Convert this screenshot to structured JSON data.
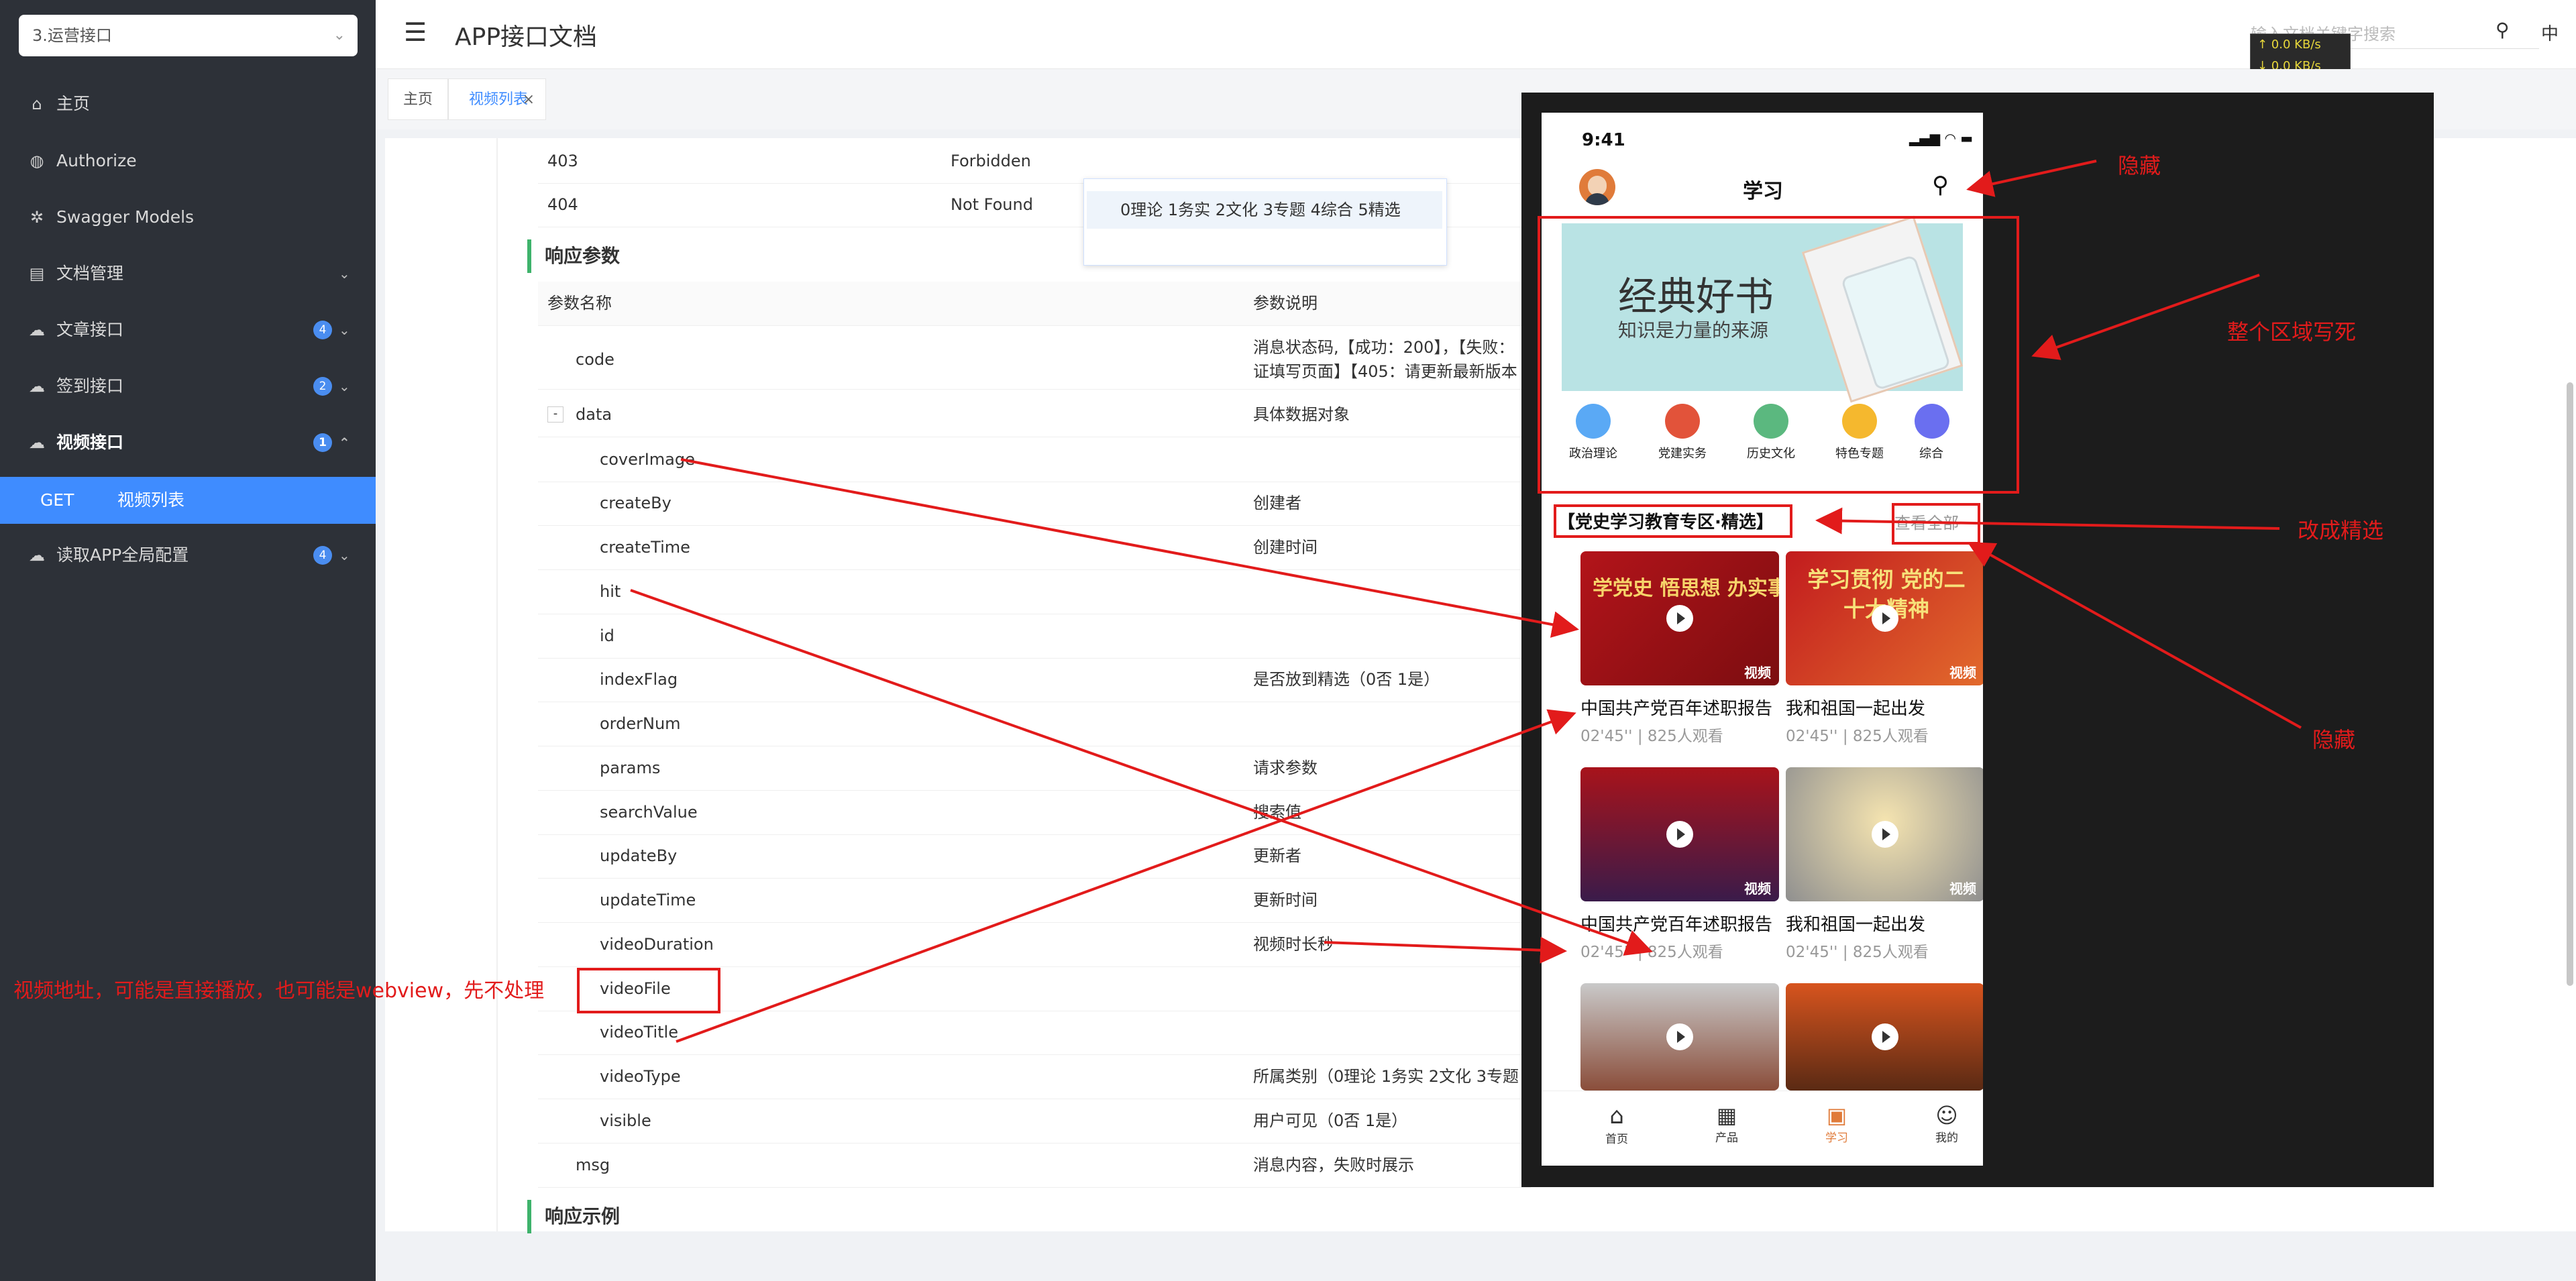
{
  "sidebar": {
    "project": "3.运营接口",
    "items": [
      {
        "label": "主页",
        "icon": "home-icon"
      },
      {
        "label": "Authorize",
        "icon": "authorize-icon"
      },
      {
        "label": "Swagger Models",
        "icon": "models-icon"
      },
      {
        "label": "文档管理",
        "icon": "docs-icon"
      },
      {
        "label": "文章接口",
        "icon": "cloud-icon",
        "badge": "4"
      },
      {
        "label": "签到接口",
        "icon": "cloud-icon",
        "badge": "2"
      },
      {
        "label": "视频接口",
        "icon": "cloud-icon",
        "badge": "1"
      },
      {
        "label": "读取APP全局配置",
        "icon": "cloud-icon",
        "badge": "4"
      }
    ],
    "sub": {
      "method": "GET",
      "label": "视频列表"
    }
  },
  "header": {
    "title": "APP接口文档",
    "search_placeholder": "输入文档关键字搜索",
    "lang": "中",
    "net_up": "↑ 0.0 KB/s",
    "net_down": "↓ 0.0 KB/s"
  },
  "tabs": [
    {
      "label": "主页"
    },
    {
      "label": "视频列表",
      "close": "×"
    }
  ],
  "tooltip": "0理论 1务实 2文化 3专题 4综合 5精选",
  "status_rows": [
    {
      "code": "403",
      "desc": "Forbidden"
    },
    {
      "code": "404",
      "desc": "Not Found"
    }
  ],
  "response": {
    "title": "响应参数",
    "col_name": "参数名称",
    "col_desc": "参数说明",
    "rows": [
      {
        "name": "code",
        "desc": "消息状态码,【成功：200】，【失败：",
        "desc2": "证填写页面】【405：请更新最新版本"
      },
      {
        "name": "data",
        "desc": "具体数据对象",
        "toggle": "-"
      },
      {
        "name": "coverImage",
        "desc": ""
      },
      {
        "name": "createBy",
        "desc": "创建者"
      },
      {
        "name": "createTime",
        "desc": "创建时间"
      },
      {
        "name": "hit",
        "desc": ""
      },
      {
        "name": "id",
        "desc": ""
      },
      {
        "name": "indexFlag",
        "desc": "是否放到精选（0否 1是）"
      },
      {
        "name": "orderNum",
        "desc": ""
      },
      {
        "name": "params",
        "desc": "请求参数"
      },
      {
        "name": "searchValue",
        "desc": "搜索值"
      },
      {
        "name": "updateBy",
        "desc": "更新者"
      },
      {
        "name": "updateTime",
        "desc": "更新时间"
      },
      {
        "name": "videoDuration",
        "desc": "视频时长秒"
      },
      {
        "name": "videoFile",
        "desc": ""
      },
      {
        "name": "videoTitle",
        "desc": ""
      },
      {
        "name": "videoType",
        "desc": "所属类别（0理论 1务实 2文化 3专题"
      },
      {
        "name": "visible",
        "desc": "用户可见（0否 1是）"
      },
      {
        "name": "msg",
        "desc": "消息内容，失败时展示"
      }
    ],
    "example_title": "响应示例"
  },
  "phone": {
    "time": "9:41",
    "title": "学习",
    "banner_title": "经典好书",
    "banner_sub": "知识是力量的来源",
    "categories": [
      {
        "label": "政治理论",
        "color": "#5aa9f5"
      },
      {
        "label": "党建实务",
        "color": "#e2533a"
      },
      {
        "label": "历史文化",
        "color": "#5bb87f"
      },
      {
        "label": "特色专题",
        "color": "#f5b82e"
      },
      {
        "label": "综合",
        "color": "#6a6ff0"
      }
    ],
    "section_title": "【党史学习教育专区·精选】",
    "view_all": "查看全部",
    "video_tag": "视频",
    "videos": [
      {
        "title": "中国共产党百年述职报告",
        "meta": "02'45'' | 825人观看",
        "thumb_text": "学党史 悟思想 办实事 开新局"
      },
      {
        "title": "我和祖国一起出发",
        "meta": "02'45'' | 825人观看",
        "thumb_text": "学习贯彻 党的二十大精神"
      },
      {
        "title": "中国共产党百年述职报告",
        "meta": "02'45'' | 825人观看"
      },
      {
        "title": "我和祖国一起出发",
        "meta": "02'45'' | 825人观看"
      }
    ],
    "tabbar": [
      "首页",
      "产品",
      "学习",
      "我的"
    ]
  },
  "annotations": {
    "hide1": "隐藏",
    "whole_area": "整个区域写死",
    "change": "改成精选",
    "hide2": "隐藏",
    "video_addr": "视频地址，可能是直接播放，也可能是webview，先不处理"
  }
}
